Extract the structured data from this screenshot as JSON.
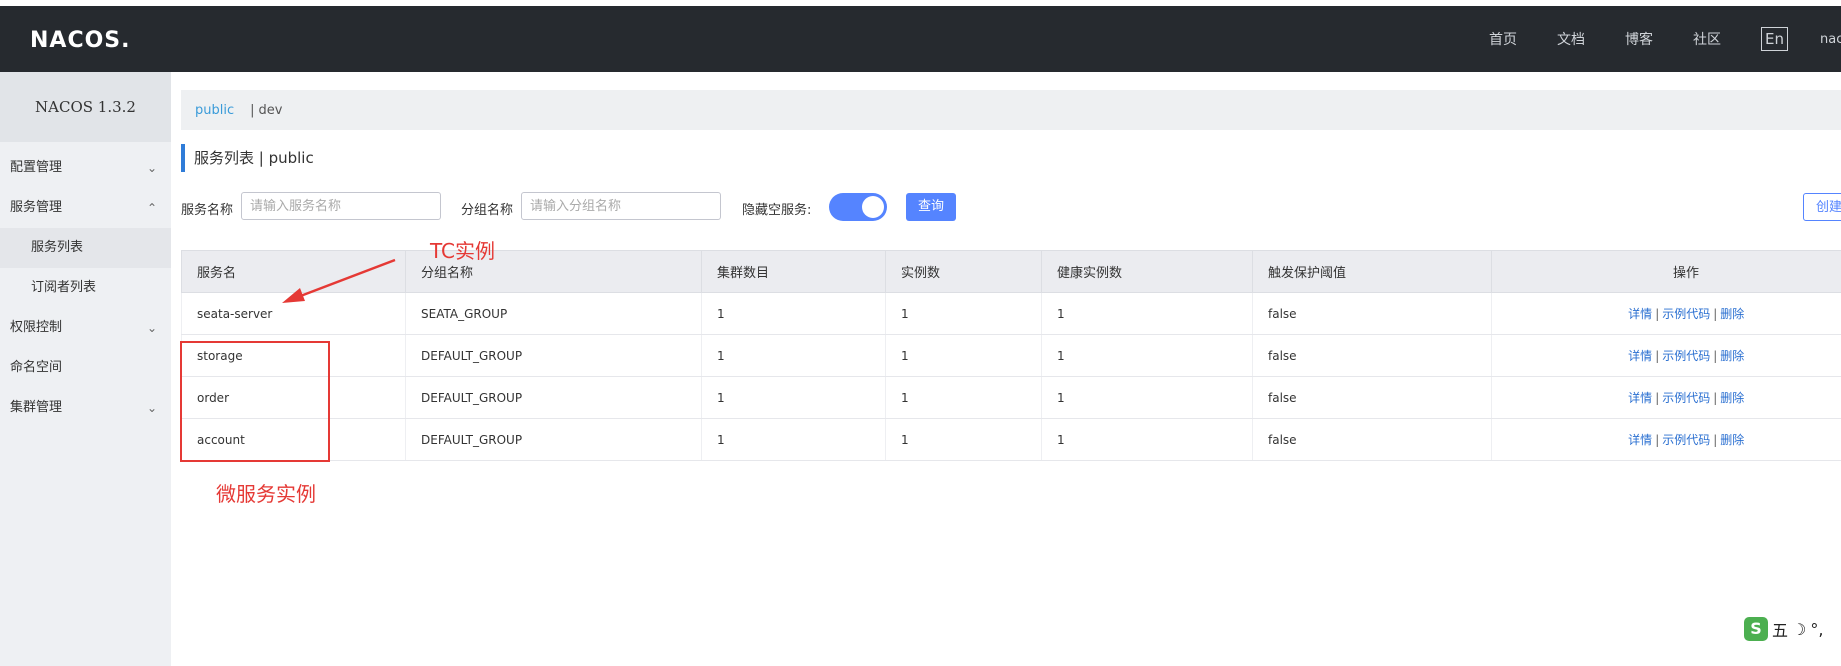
{
  "header": {
    "logo": "NACOS.",
    "nav": [
      "首页",
      "文档",
      "博客",
      "社区"
    ],
    "lang": "En",
    "user": "nacos"
  },
  "sidebar": {
    "version": "NACOS 1.3.2",
    "config_mgmt": "配置管理",
    "service_mgmt": "服务管理",
    "service_list": "服务列表",
    "subscriber_list": "订阅者列表",
    "permission": "权限控制",
    "namespace": "命名空间",
    "cluster_mgmt": "集群管理"
  },
  "namespace_bar": {
    "current": "public",
    "separator": "|",
    "other": "dev"
  },
  "page": {
    "title": "服务列表  |  public"
  },
  "filters": {
    "service_name_label": "服务名称",
    "service_name_placeholder": "请输入服务名称",
    "group_name_label": "分组名称",
    "group_name_placeholder": "请输入分组名称",
    "hide_empty_label": "隐藏空服务:",
    "hide_empty_on": true,
    "query_label": "查询",
    "create_label": "创建服务"
  },
  "table": {
    "headers": [
      "服务名",
      "分组名称",
      "集群数目",
      "实例数",
      "健康实例数",
      "触发保护阈值",
      "操作"
    ],
    "rows": [
      {
        "name": "seata-server",
        "group": "SEATA_GROUP",
        "clusters": "1",
        "instances": "1",
        "healthy": "1",
        "threshold": "false"
      },
      {
        "name": "storage",
        "group": "DEFAULT_GROUP",
        "clusters": "1",
        "instances": "1",
        "healthy": "1",
        "threshold": "false"
      },
      {
        "name": "order",
        "group": "DEFAULT_GROUP",
        "clusters": "1",
        "instances": "1",
        "healthy": "1",
        "threshold": "false"
      },
      {
        "name": "account",
        "group": "DEFAULT_GROUP",
        "clusters": "1",
        "instances": "1",
        "healthy": "1",
        "threshold": "false"
      }
    ],
    "ops": {
      "detail": "详情",
      "sample_code": "示例代码",
      "delete": "删除",
      "sep": "|"
    }
  },
  "annotations": {
    "tc": "TC实例",
    "micro": "微服务实例",
    "color": "#e53935"
  },
  "ime": {
    "logo": "S",
    "mode": "五",
    "moon": "☽",
    "punct": "°,"
  }
}
